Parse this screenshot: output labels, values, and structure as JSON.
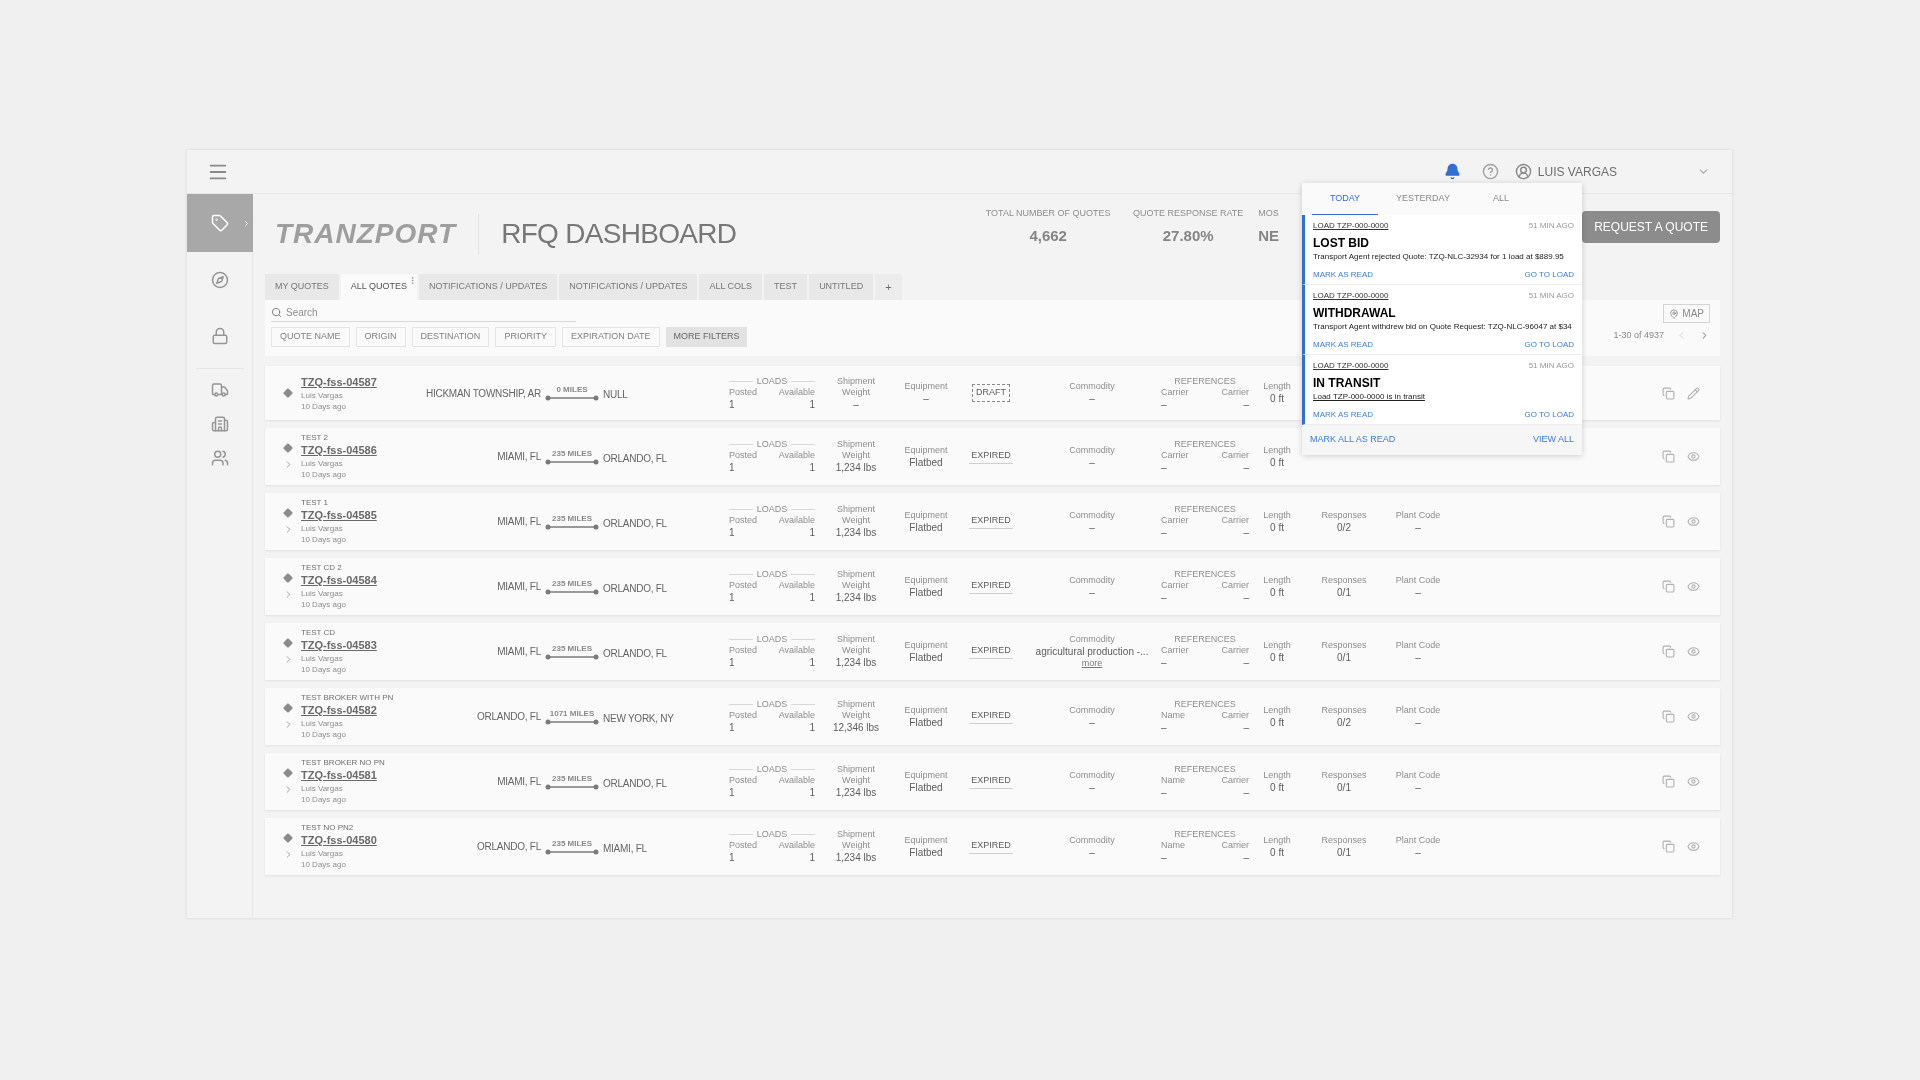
{
  "header": {
    "user": "LUIS VARGAS",
    "bell_active": true
  },
  "sidebar": {
    "items": [
      {
        "kind": "tag",
        "selected": true
      },
      {
        "kind": "compass",
        "selected": false
      },
      {
        "kind": "lock",
        "selected": false
      },
      {
        "kind": "truck",
        "selected": false
      },
      {
        "kind": "building",
        "selected": false
      },
      {
        "kind": "users",
        "selected": false
      }
    ]
  },
  "logo": "TRANZPORT",
  "title": "RFQ DASHBOARD",
  "metrics": [
    {
      "label": "TOTAL NUMBER OF QUOTES",
      "value": "4,662"
    },
    {
      "label": "QUOTE RESPONSE RATE",
      "value": "27.80%"
    },
    {
      "label": "MOS",
      "value": "NE"
    }
  ],
  "request_button": "REQUEST A QUOTE",
  "tabs": [
    {
      "label": "MY QUOTES",
      "selected": false
    },
    {
      "label": "ALL QUOTES",
      "selected": true
    },
    {
      "label": "NOTIFICATIONS / UPDATES",
      "selected": false
    },
    {
      "label": "NOTIFICATIONS / UPDATES",
      "selected": false
    },
    {
      "label": "ALL COLS",
      "selected": false
    },
    {
      "label": "TEST",
      "selected": false
    },
    {
      "label": "UNTITLED",
      "selected": false
    }
  ],
  "add_tab": "+",
  "search": {
    "placeholder": "Search"
  },
  "filters": [
    {
      "label": "QUOTE NAME",
      "kind": "filter"
    },
    {
      "label": "ORIGIN",
      "kind": "filter"
    },
    {
      "label": "DESTINATION",
      "kind": "filter"
    },
    {
      "label": "PRIORITY",
      "kind": "filter"
    },
    {
      "label": "EXPIRATION DATE",
      "kind": "filter"
    },
    {
      "label": "MORE FILTERS",
      "kind": "more"
    }
  ],
  "map_button": "MAP",
  "pagination": {
    "text": "1-30 of 4937",
    "prev_disabled": true,
    "next_disabled": false
  },
  "rows": [
    {
      "id": "TZQ-fss-04587",
      "owner": "Luis Vargas",
      "age": "10 Days ago",
      "expandable": false,
      "origin": "HICKMAN TOWNSHIP, AR",
      "miles": "0 MILES",
      "destination": "NULL",
      "loads_label": "LOADS",
      "posted_label": "Posted",
      "posted": "1",
      "available_label": "Available",
      "available": "1",
      "weight_label": "Shipment Weight",
      "weight": "–",
      "equipment_label": "Equipment",
      "equipment": "–",
      "status": {
        "kind": "draft",
        "label": "DRAFT"
      },
      "commodity_label": "Commodity",
      "commodity": "–",
      "references_label": "REFERENCES",
      "refs": [
        {
          "label": "Carrier",
          "value": "–"
        },
        {
          "label": "Carrier",
          "value": "–"
        }
      ],
      "length_label": "Length",
      "length": "0 ft"
    },
    {
      "title": "TEST 2",
      "id": "TZQ-fss-04586",
      "owner": "Luis Vargas",
      "age": "10 Days ago",
      "expandable": true,
      "origin": "MIAMI, FL",
      "miles": "235 MILES",
      "destination": "ORLANDO, FL",
      "loads_label": "LOADS",
      "posted_label": "Posted",
      "posted": "1",
      "available_label": "Available",
      "available": "1",
      "weight_label": "Shipment Weight",
      "weight": "1,234 lbs",
      "equipment_label": "Equipment",
      "equipment": "Flatbed",
      "status": {
        "kind": "expired",
        "label": "EXPIRED"
      },
      "commodity_label": "Commodity",
      "commodity": "–",
      "references_label": "REFERENCES",
      "refs": [
        {
          "label": "Carrier",
          "value": "–"
        },
        {
          "label": "Carrier",
          "value": "–"
        }
      ],
      "length_label": "Length",
      "length": "0 ft"
    },
    {
      "title": "TEST 1",
      "id": "TZQ-fss-04585",
      "owner": "Luis Vargas",
      "age": "10 Days ago",
      "expandable": true,
      "origin": "MIAMI, FL",
      "miles": "235 MILES",
      "destination": "ORLANDO, FL",
      "loads_label": "LOADS",
      "posted_label": "Posted",
      "posted": "1",
      "available_label": "Available",
      "available": "1",
      "weight_label": "Shipment Weight",
      "weight": "1,234 lbs",
      "equipment_label": "Equipment",
      "equipment": "Flatbed",
      "status": {
        "kind": "expired",
        "label": "EXPIRED"
      },
      "commodity_label": "Commodity",
      "commodity": "–",
      "references_label": "REFERENCES",
      "refs": [
        {
          "label": "Carrier",
          "value": "–"
        },
        {
          "label": "Carrier",
          "value": "–"
        }
      ],
      "length_label": "Length",
      "length": "0 ft",
      "responses_label": "Responses",
      "responses": "0/2",
      "plant_code_label": "Plant Code",
      "plant_code": "–"
    },
    {
      "title": "TEST CD 2",
      "id": "TZQ-fss-04584",
      "owner": "Luis Vargas",
      "age": "10 Days ago",
      "expandable": true,
      "origin": "MIAMI, FL",
      "miles": "235 MILES",
      "destination": "ORLANDO, FL",
      "loads_label": "LOADS",
      "posted_label": "Posted",
      "posted": "1",
      "available_label": "Available",
      "available": "1",
      "weight_label": "Shipment Weight",
      "weight": "1,234 lbs",
      "equipment_label": "Equipment",
      "equipment": "Flatbed",
      "status": {
        "kind": "expired",
        "label": "EXPIRED"
      },
      "commodity_label": "Commodity",
      "commodity": "–",
      "references_label": "REFERENCES",
      "refs": [
        {
          "label": "Carrier",
          "value": "–"
        },
        {
          "label": "Carrier",
          "value": "–"
        }
      ],
      "length_label": "Length",
      "length": "0 ft",
      "responses_label": "Responses",
      "responses": "0/1",
      "plant_code_label": "Plant Code",
      "plant_code": "–"
    },
    {
      "title": "TEST CD",
      "id": "TZQ-fss-04583",
      "owner": "Luis Vargas",
      "age": "10 Days ago",
      "expandable": true,
      "origin": "MIAMI, FL",
      "miles": "235 MILES",
      "destination": "ORLANDO, FL",
      "loads_label": "LOADS",
      "posted_label": "Posted",
      "posted": "1",
      "available_label": "Available",
      "available": "1",
      "weight_label": "Shipment Weight",
      "weight": "1,234 lbs",
      "equipment_label": "Equipment",
      "equipment": "Flatbed",
      "status": {
        "kind": "expired",
        "label": "EXPIRED"
      },
      "commodity_label": "Commodity",
      "commodity": "agricultural production -...",
      "commodity_more": "more",
      "references_label": "REFERENCES",
      "refs": [
        {
          "label": "Carrier",
          "value": "–"
        },
        {
          "label": "Carrier",
          "value": "–"
        }
      ],
      "length_label": "Length",
      "length": "0 ft",
      "responses_label": "Responses",
      "responses": "0/1",
      "plant_code_label": "Plant Code",
      "plant_code": "–"
    },
    {
      "title": "TEST BROKER WITH PN",
      "id": "TZQ-fss-04582",
      "owner": "Luis Vargas",
      "age": "10 Days ago",
      "expandable": true,
      "origin": "ORLANDO, FL",
      "miles": "1071 MILES",
      "destination": "NEW YORK, NY",
      "loads_label": "LOADS",
      "posted_label": "Posted",
      "posted": "1",
      "available_label": "Available",
      "available": "1",
      "weight_label": "Shipment Weight",
      "weight": "12,346 lbs",
      "equipment_label": "Equipment",
      "equipment": "Flatbed",
      "status": {
        "kind": "expired",
        "label": "EXPIRED"
      },
      "commodity_label": "Commodity",
      "commodity": "–",
      "references_label": "REFERENCES",
      "refs": [
        {
          "label": "Name",
          "value": "–"
        },
        {
          "label": "Carrier",
          "value": "–"
        }
      ],
      "length_label": "Length",
      "length": "0 ft",
      "responses_label": "Responses",
      "responses": "0/2",
      "plant_code_label": "Plant Code",
      "plant_code": "–"
    },
    {
      "title": "TEST BROKER NO PN",
      "id": "TZQ-fss-04581",
      "owner": "Luis Vargas",
      "age": "10 Days ago",
      "expandable": true,
      "origin": "MIAMI, FL",
      "miles": "235 MILES",
      "destination": "ORLANDO, FL",
      "loads_label": "LOADS",
      "posted_label": "Posted",
      "posted": "1",
      "available_label": "Available",
      "available": "1",
      "weight_label": "Shipment Weight",
      "weight": "1,234 lbs",
      "equipment_label": "Equipment",
      "equipment": "Flatbed",
      "status": {
        "kind": "expired",
        "label": "EXPIRED"
      },
      "commodity_label": "Commodity",
      "commodity": "–",
      "references_label": "REFERENCES",
      "refs": [
        {
          "label": "Name",
          "value": "–"
        },
        {
          "label": "Carrier",
          "value": "–"
        }
      ],
      "length_label": "Length",
      "length": "0 ft",
      "responses_label": "Responses",
      "responses": "0/1",
      "plant_code_label": "Plant Code",
      "plant_code": "–"
    },
    {
      "title": "TEST NO PN2",
      "id": "TZQ-fss-04580",
      "owner": "Luis Vargas",
      "age": "10 Days ago",
      "expandable": true,
      "origin": "ORLANDO, FL",
      "miles": "235 MILES",
      "destination": "MIAMI, FL",
      "loads_label": "LOADS",
      "posted_label": "Posted",
      "posted": "1",
      "available_label": "Available",
      "available": "1",
      "weight_label": "Shipment Weight",
      "weight": "1,234 lbs",
      "equipment_label": "Equipment",
      "equipment": "Flatbed",
      "status": {
        "kind": "expired",
        "label": "EXPIRED"
      },
      "commodity_label": "Commodity",
      "commodity": "–",
      "references_label": "REFERENCES",
      "refs": [
        {
          "label": "Name",
          "value": "–"
        },
        {
          "label": "Carrier",
          "value": "–"
        }
      ],
      "length_label": "Length",
      "length": "0 ft",
      "responses_label": "Responses",
      "responses": "0/1",
      "plant_code_label": "Plant Code",
      "plant_code": "–"
    }
  ],
  "notifications": {
    "tabs": [
      {
        "label": "TODAY",
        "selected": true
      },
      {
        "label": "YESTERDAY",
        "selected": false
      },
      {
        "label": "ALL",
        "selected": false
      }
    ],
    "items": [
      {
        "load": "LOAD TZP-000-0000",
        "time": "51 MIN AGO",
        "title": "LOST BID",
        "message": "Transport Agent rejected Quote: TZQ-NLC-32934 for 1 load at $889.95",
        "message_link": false,
        "unread": true,
        "mark_read": "MARK AS READ",
        "go_to": "GO TO LOAD"
      },
      {
        "load": "LOAD TZP-000-0000",
        "time": "51 MIN AGO",
        "title": "WITHDRAWAL",
        "message": "Transport Agent withdrew bid on Quote Request: TZQ-NLC-96047 at $34",
        "message_link": false,
        "unread": true,
        "mark_read": "MARK AS READ",
        "go_to": "GO TO LOAD"
      },
      {
        "load": "LOAD TZP-000-0000",
        "time": "51 MIN AGO",
        "title": "IN TRANSIT",
        "message": "Load TZP-000-0000 is in transit",
        "message_link": true,
        "unread": true,
        "mark_read": "MARK AS READ",
        "go_to": "GO TO LOAD"
      }
    ],
    "mark_all": "MARK ALL AS READ",
    "view_all": "VIEW ALL"
  }
}
